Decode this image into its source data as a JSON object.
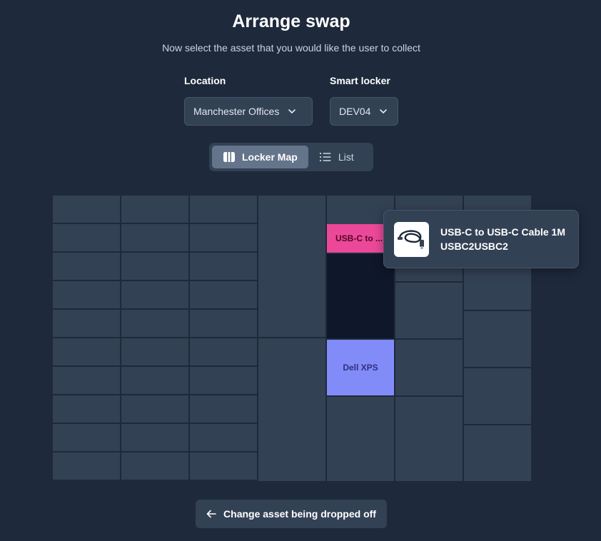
{
  "header": {
    "title": "Arrange swap",
    "subtitle": "Now select the asset that you would like the user to collect"
  },
  "filters": {
    "location": {
      "label": "Location",
      "value": "Manchester Offices"
    },
    "smart_locker": {
      "label": "Smart locker",
      "value": "DEV04"
    }
  },
  "view_toggle": {
    "options": [
      {
        "label": "Locker Map",
        "icon": "locker-columns-icon",
        "active": true
      },
      {
        "label": "List",
        "icon": "list-icon",
        "active": false
      }
    ]
  },
  "locker": {
    "assets": [
      {
        "label": "USB-C to ...",
        "color": "#ec4899"
      },
      {
        "label": "Dell XPS",
        "color": "#818cf8"
      }
    ]
  },
  "tooltip": {
    "name": "USB-C to USB-C Cable 1M",
    "code": "USBC2USBC2",
    "image_icon": "usb-cable-icon"
  },
  "footer": {
    "back_label": "Change asset being dropped off",
    "back_icon": "arrow-left-icon"
  },
  "colors": {
    "background": "#1e293b",
    "panel": "#334155",
    "empty_locker": "#0f172a",
    "asset_pink": "#ec4899",
    "asset_purple": "#818cf8"
  }
}
